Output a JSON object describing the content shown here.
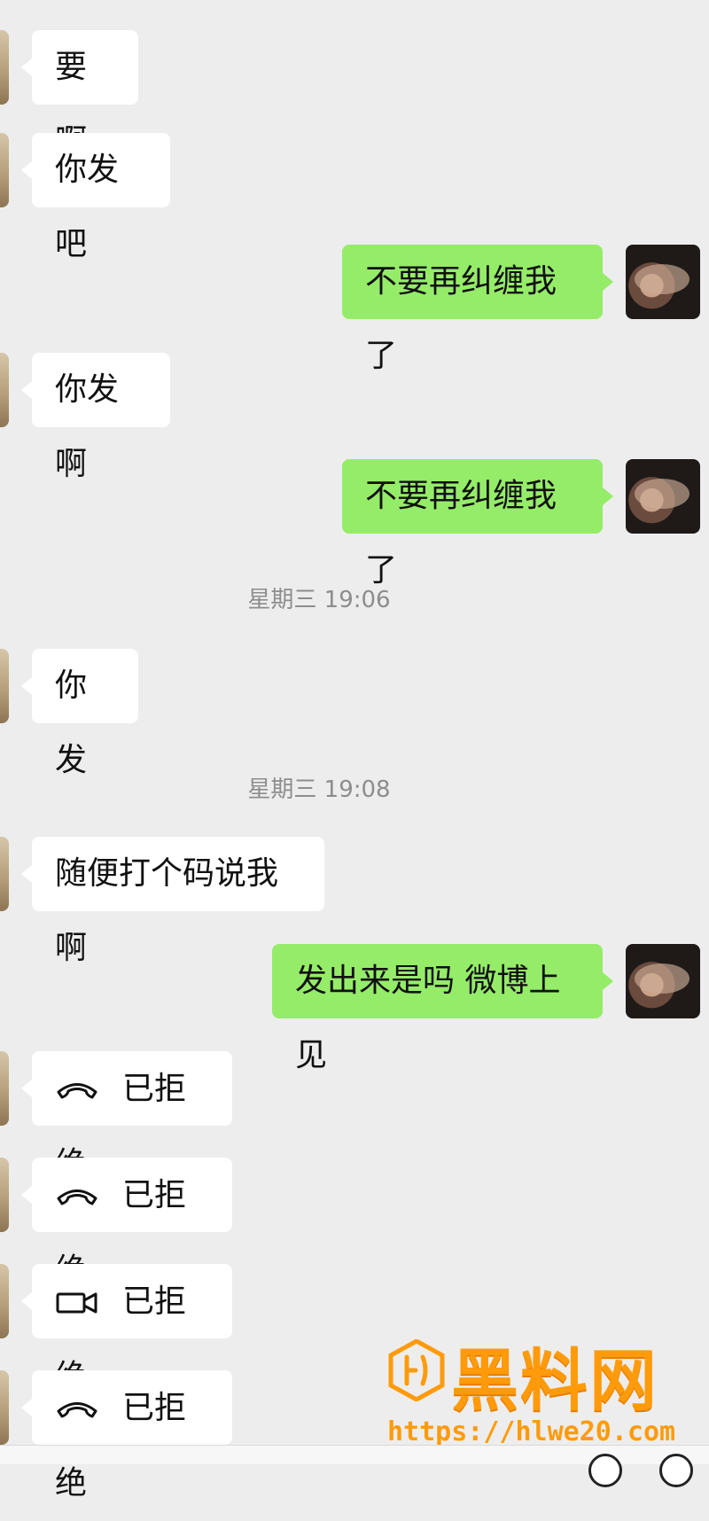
{
  "chat": {
    "messages": [
      {
        "side": "left",
        "text": "要啊"
      },
      {
        "side": "left",
        "text": "你发吧"
      },
      {
        "side": "right",
        "text": "不要再纠缠我了"
      },
      {
        "side": "left",
        "text": "你发啊"
      },
      {
        "side": "right",
        "text": "不要再纠缠我了"
      },
      {
        "type": "timestamp",
        "text": "星期三 19:06"
      },
      {
        "side": "left",
        "text": "你发"
      },
      {
        "type": "timestamp",
        "text": "星期三 19:08"
      },
      {
        "side": "left",
        "text": "随便打个码说我啊"
      },
      {
        "side": "right",
        "text": "发出来是吗 微博上见"
      },
      {
        "side": "left",
        "type": "call",
        "call_icon": "phone-declined-icon",
        "text": "已拒绝"
      },
      {
        "side": "left",
        "type": "call",
        "call_icon": "phone-declined-icon",
        "text": "已拒绝"
      },
      {
        "side": "left",
        "type": "call",
        "call_icon": "video-call-icon",
        "text": "已拒绝"
      },
      {
        "side": "left",
        "type": "call",
        "call_icon": "phone-declined-icon",
        "text": "已拒绝"
      }
    ]
  },
  "watermark": {
    "title": "黑料网",
    "url": "https://hlwe20.com",
    "color": "#ff9b0a"
  },
  "colors": {
    "background": "#ededed",
    "outgoing_bubble": "#95ec69",
    "incoming_bubble": "#ffffff",
    "timestamp_text": "#8d8d8d"
  }
}
